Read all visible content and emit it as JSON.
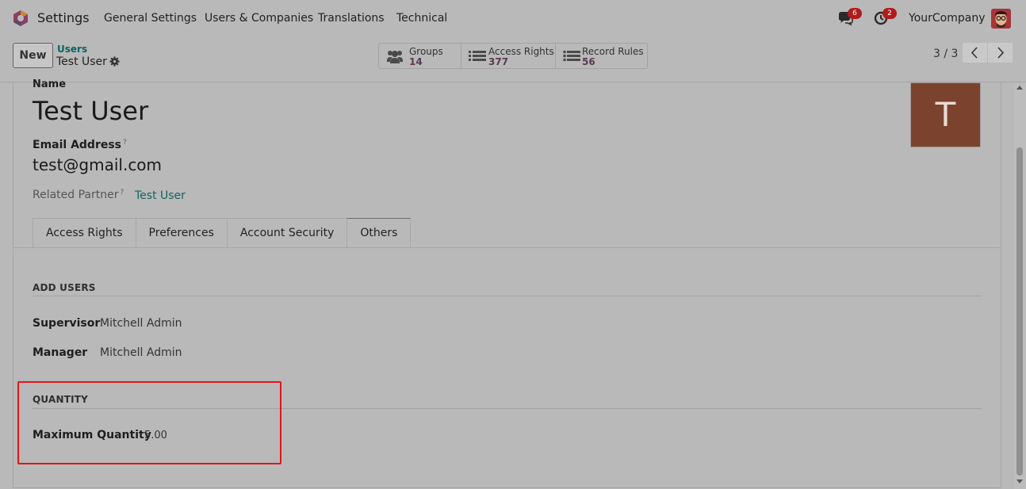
{
  "navbar": {
    "app_title": "Settings",
    "menu": [
      "General Settings",
      "Users & Companies",
      "Translations",
      "Technical"
    ],
    "messages_badge": "6",
    "activities_badge": "2",
    "company": "YourCompany"
  },
  "control_panel": {
    "new_label": "New",
    "breadcrumb_parent": "Users",
    "breadcrumb_current": "Test User",
    "smart_buttons": [
      {
        "label": "Groups",
        "value": "14",
        "icon": "users-icon"
      },
      {
        "label": "Access Rights",
        "value": "377",
        "icon": "list-icon"
      },
      {
        "label": "Record Rules",
        "value": "56",
        "icon": "list-icon"
      }
    ],
    "pager": "3 / 3"
  },
  "form": {
    "name_label": "Name",
    "name_value": "Test User",
    "email_label": "Email Address",
    "email_help": "?",
    "email_value": "test@gmail.com",
    "related_partner_label": "Related Partner",
    "related_partner_help": "?",
    "related_partner_value": "Test User",
    "avatar_letter": "T",
    "tabs": [
      "Access Rights",
      "Preferences",
      "Account Security",
      "Others"
    ],
    "active_tab": "Others",
    "sections": {
      "add_users": {
        "title": "ADD USERS",
        "supervisor_label": "Supervisor",
        "supervisor_value": "Mitchell Admin",
        "manager_label": "Manager",
        "manager_value": "Mitchell Admin"
      },
      "quantity": {
        "title": "QUANTITY",
        "max_label": "Maximum Quantity",
        "max_value": "5.00"
      }
    }
  },
  "colors": {
    "highlight_border": "#e2151b",
    "avatar_bg": "#7b432d",
    "link": "#136464",
    "badge": "#b01b1b"
  }
}
